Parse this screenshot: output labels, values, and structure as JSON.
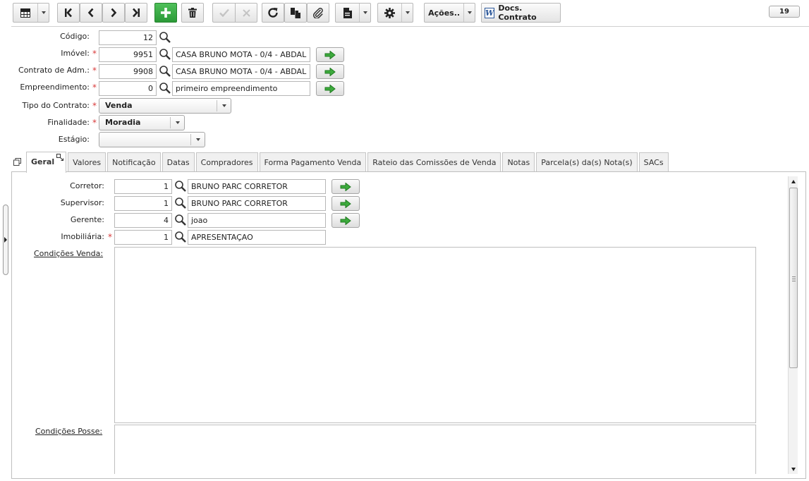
{
  "toolbar": {
    "actions_label": "Ações..",
    "docs_label": "Docs. Contrato",
    "docs_icon_letter": "W",
    "record_counter": "19"
  },
  "header_fields": {
    "codigo": {
      "label": "Código:",
      "value": "12"
    },
    "imovel": {
      "label": "Imóvel:",
      "code": "9951",
      "description": "CASA BRUNO MOTA - 0/4 - ABDAL"
    },
    "contrato_adm": {
      "label": "Contrato de Adm.:",
      "code": "9908",
      "description": "CASA BRUNO MOTA - 0/4 - ABDAL"
    },
    "empreendimento": {
      "label": "Empreendimento:",
      "code": "0",
      "description": "primeiro empreendimento"
    },
    "tipo_contrato": {
      "label": "Tipo do Contrato:",
      "value": "Venda"
    },
    "finalidade": {
      "label": "Finalidade:",
      "value": "Moradia"
    },
    "estagio": {
      "label": "Estágio:",
      "value": ""
    },
    "required_marker": "*"
  },
  "tabs": [
    {
      "label": "Geral"
    },
    {
      "label": "Valores"
    },
    {
      "label": "Notificação"
    },
    {
      "label": "Datas"
    },
    {
      "label": "Compradores"
    },
    {
      "label": "Forma Pagamento Venda"
    },
    {
      "label": "Rateio das Comissões de Venda"
    },
    {
      "label": "Notas"
    },
    {
      "label": "Parcela(s) da(s) Nota(s)"
    },
    {
      "label": "SACs"
    }
  ],
  "geral": {
    "corretor": {
      "label": "Corretor:",
      "code": "1",
      "description": "BRUNO PARC CORRETOR"
    },
    "supervisor": {
      "label": "Supervisor:",
      "code": "1",
      "description": "BRUNO PARC CORRETOR"
    },
    "gerente": {
      "label": "Gerente:",
      "code": "4",
      "description": "joao"
    },
    "imobiliaria": {
      "label": "Imobiliária:",
      "code": "1",
      "description": "APRESENTAÇAO"
    },
    "condicoes_venda": {
      "label": "Condições Venda:",
      "value": ""
    },
    "condicoes_posse": {
      "label": "Condições Posse:",
      "value": ""
    }
  },
  "colors": {
    "add_button": "#2b9a37",
    "required": "#d83a3a",
    "go_arrow": "#3daa3d"
  }
}
